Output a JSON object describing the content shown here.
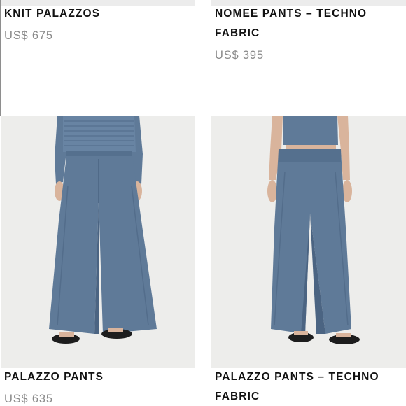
{
  "products": [
    {
      "title_lines": [
        "KNIT PALAZZOS"
      ],
      "price": "US$ 675"
    },
    {
      "title_lines": [
        "NOMEE PANTS – TECHNO",
        "FABRIC"
      ],
      "price": "US$ 395"
    },
    {
      "title_lines": [
        "PALAZZO PANTS"
      ],
      "price": "US$ 635"
    },
    {
      "title_lines": [
        "PALAZZO PANTS – TECHNO",
        "FABRIC"
      ],
      "price": ""
    }
  ],
  "colors": {
    "background": "#ffffff",
    "photo_background": "#ededeb",
    "title_text": "#111111",
    "price_text": "#8a8a8a",
    "garment_blue": "#5f7a98",
    "garment_blue_dark": "#4b6482",
    "skin": "#d9b49c",
    "sandal": "#1d1d1d"
  }
}
